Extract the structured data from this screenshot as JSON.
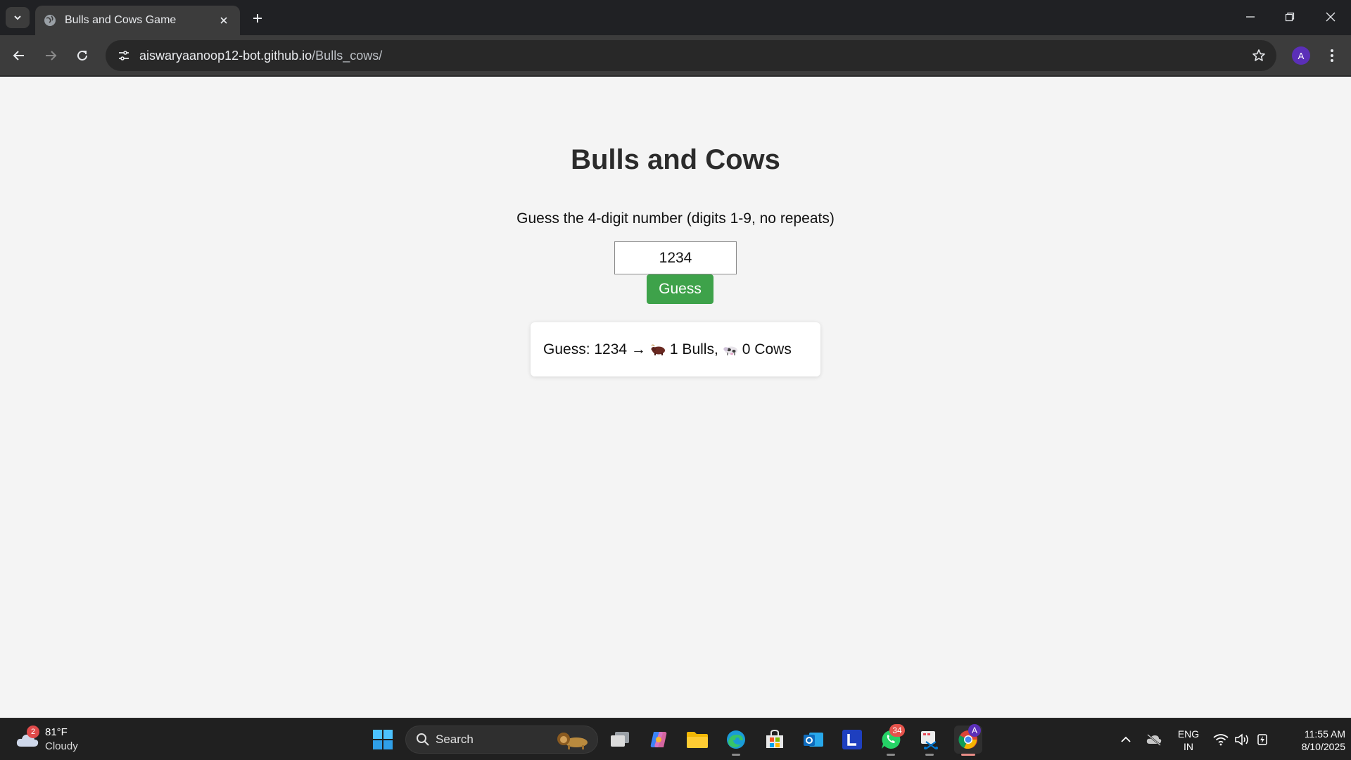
{
  "browser": {
    "tab_title": "Bulls and Cows Game",
    "url_host": "aiswaryaanoop12-bot.github.io",
    "url_path": "/Bulls_cows/",
    "profile_initial": "A"
  },
  "game": {
    "title": "Bulls and Cows",
    "instructions": "Guess the 4-digit number (digits 1-9, no repeats)",
    "input_value": "1234",
    "guess_button_label": "Guess",
    "result": {
      "prefix": "Guess: 1234 →",
      "bulls_text": "1 Bulls,",
      "cows_text": "0 Cows",
      "bull_icon": "bull-emoji",
      "cow_icon": "cow-emoji"
    },
    "colors": {
      "guess_button": "#3ea24a",
      "background": "#f4f4f4"
    }
  },
  "taskbar": {
    "weather_temp": "81°F",
    "weather_condition": "Cloudy",
    "weather_badge": "2",
    "search_label": "Search",
    "whatsapp_badge": "34",
    "language_line1": "ENG",
    "language_line2": "IN",
    "time": "11:55 AM",
    "date": "8/10/2025"
  }
}
